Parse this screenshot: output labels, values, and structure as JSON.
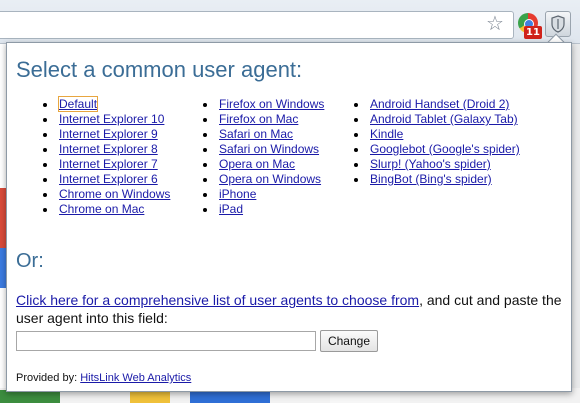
{
  "browser": {
    "extension_badge": "11",
    "icons": [
      "star-icon",
      "extension-icon",
      "shield-icon"
    ]
  },
  "popup": {
    "title": "Select a common user agent:",
    "columns": [
      [
        "Default",
        "Internet Explorer 10",
        "Internet Explorer 9",
        "Internet Explorer 8",
        "Internet Explorer 7",
        "Internet Explorer 6",
        "Chrome on Windows",
        "Chrome on Mac"
      ],
      [
        "Firefox on Windows",
        "Firefox on Mac",
        "Safari on Mac",
        "Safari on Windows",
        "Opera on Mac",
        "Opera on Windows",
        "iPhone",
        "iPad"
      ],
      [
        "Android Handset (Droid 2)",
        "Android Tablet (Galaxy Tab)",
        "Kindle",
        "Googlebot (Google's spider)",
        "Slurp! (Yahoo's spider)",
        "BingBot (Bing's spider)"
      ]
    ],
    "selected": "Default",
    "or_label": "Or:",
    "link_text": "Click here for a comprehensive list of user agents to choose from",
    "instruction_rest": ", and cut and paste the user agent into this field:",
    "input_value": "",
    "change_button": "Change",
    "provided_by_label": "Provided by:",
    "provider_link": "HitsLink Web Analytics"
  }
}
